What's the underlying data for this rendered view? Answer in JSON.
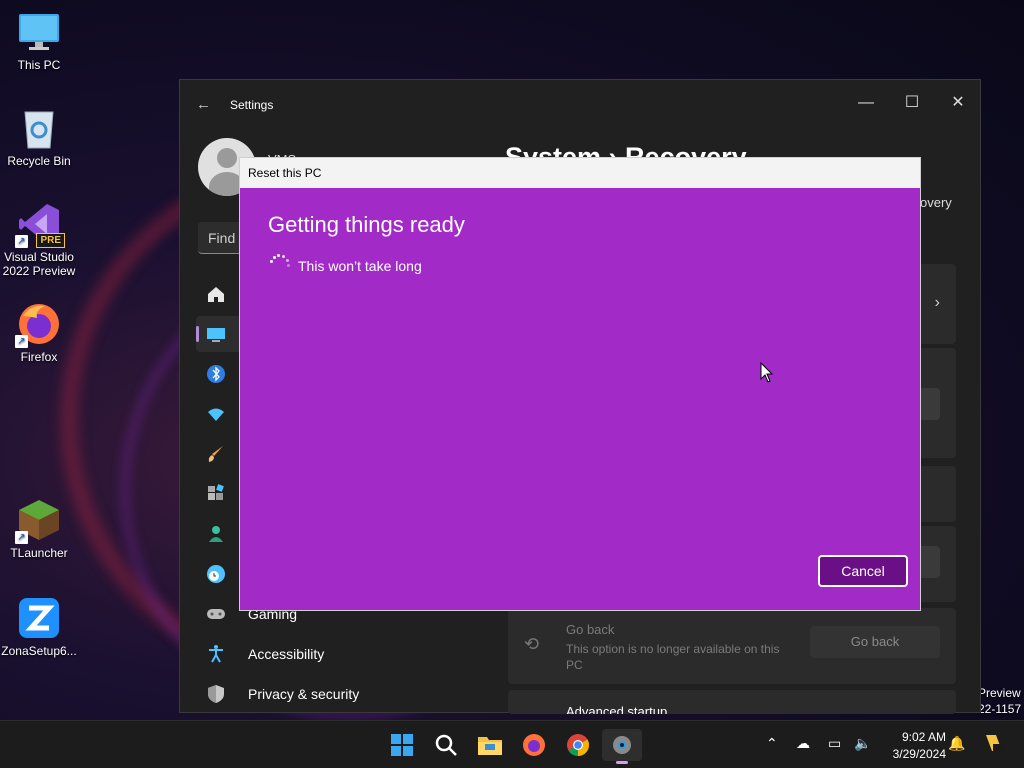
{
  "desktop": {
    "icons": [
      {
        "label": "This PC"
      },
      {
        "label": "Recycle Bin"
      },
      {
        "label": "Visual Studio 2022 Preview",
        "badge": "PRE"
      },
      {
        "label": "Firefox"
      },
      {
        "label": "TLauncher"
      },
      {
        "label": "ZonaSetup6..."
      }
    ],
    "edge_text_1": "Preview",
    "edge_text_2": "22-1157"
  },
  "settings": {
    "title": "Settings",
    "account_name_partial": "VMS",
    "search_placeholder": "Find a",
    "breadcrumb": "System  ›  Recovery",
    "subtext": "overy",
    "nav": [
      {
        "label": "",
        "icon": "home-icon"
      },
      {
        "label": "",
        "icon": "system-icon"
      },
      {
        "label": "",
        "icon": "bluetooth-icon"
      },
      {
        "label": "",
        "icon": "network-icon"
      },
      {
        "label": "",
        "icon": "personalization-icon"
      },
      {
        "label": "",
        "icon": "apps-icon"
      },
      {
        "label": "",
        "icon": "accounts-icon"
      },
      {
        "label": "",
        "icon": "time-language-icon"
      },
      {
        "label": "Gaming",
        "icon": "gaming-icon"
      },
      {
        "label": "Accessibility",
        "icon": "accessibility-icon"
      },
      {
        "label": "Privacy & security",
        "icon": "shield-icon"
      }
    ],
    "go_back": {
      "title": "Go back",
      "description": "This option is no longer available on this PC",
      "button": "Go back"
    },
    "advanced_startup_partial": "Advanced startup"
  },
  "dialog": {
    "title": "Reset this PC",
    "heading": "Getting things ready",
    "status": "This won’t take long",
    "cancel": "Cancel",
    "background_color": "#a22bc8"
  },
  "taskbar": {
    "time": "9:02 AM",
    "date": "3/29/2024"
  }
}
